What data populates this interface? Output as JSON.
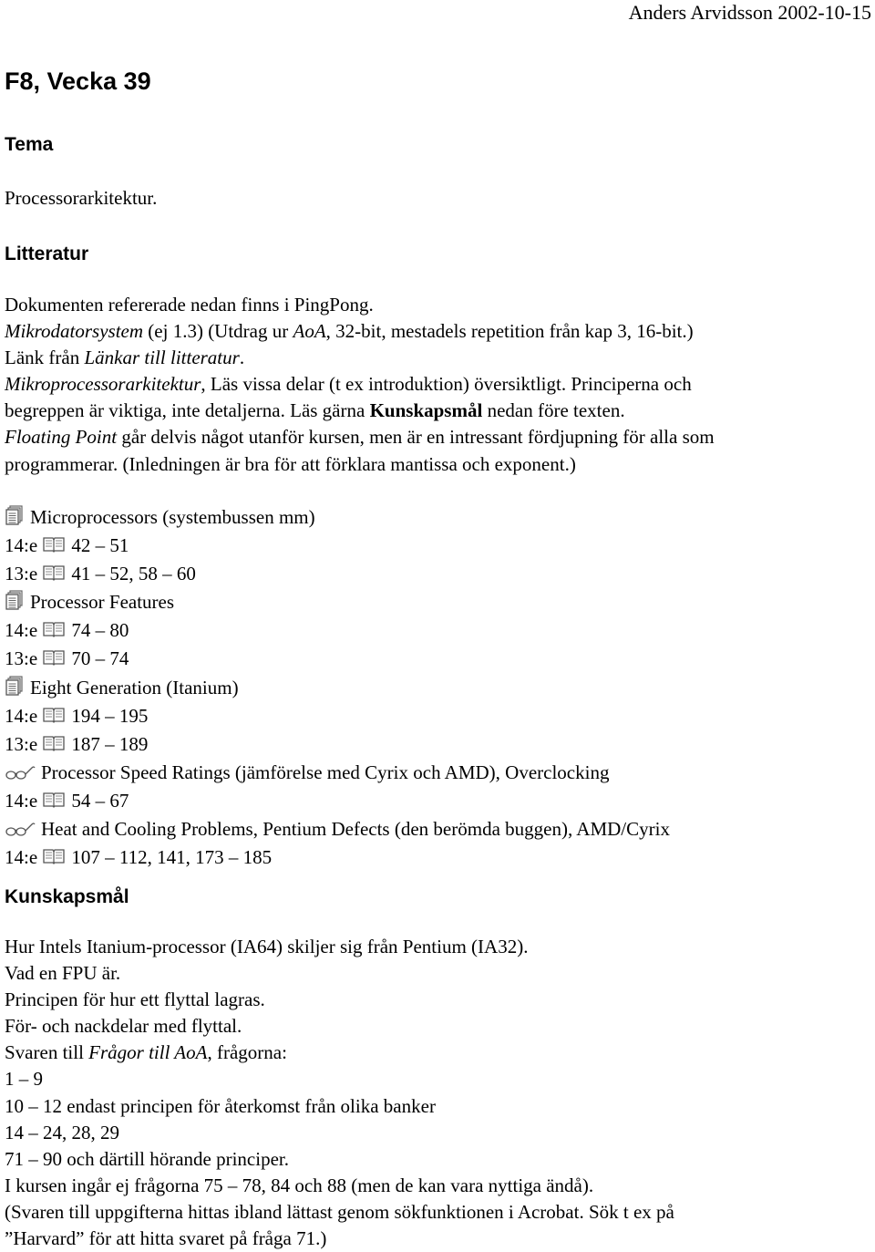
{
  "header": {
    "author_date": "Anders Arvidsson 2002-10-15"
  },
  "title": "F8, Vecka 39",
  "tema": {
    "heading": "Tema",
    "text": "Processorarkitektur."
  },
  "litteratur": {
    "heading": "Litteratur",
    "intro": "Dokumenten refererade nedan finns i PingPong.",
    "line1": {
      "title": "Mikrodatorsystem",
      "mid": " (ej 1.3) (Utdrag ur ",
      "aoa": "AoA",
      "rest": ", 32-bit, mestadels repetition från kap 3, 16-bit.)"
    },
    "line2": {
      "prefix": "Länk från ",
      "link": "Länkar till litteratur",
      "suffix": "."
    },
    "line3": {
      "title": "Mikroprocessorarkitektur",
      "rest1": ", Läs vissa delar (t ex introduktion) översiktligt. Principerna och",
      "rest2a": "begreppen är viktiga, inte detaljerna. Läs gärna ",
      "bold": "Kunskapsmål",
      "rest2b": " nedan före texten."
    },
    "line4": {
      "title": "Floating Point",
      "rest1": " går delvis något utanför kursen, men är en intressant fördjupning för alla som",
      "rest2": "programmerar. (Inledningen är bra för att förklara mantissa och exponent.)"
    }
  },
  "readings": [
    {
      "icon": "documents-icon",
      "title": "Microprocessors (systembussen mm)",
      "refs": [
        {
          "edition": "14:e",
          "icon": "book-icon",
          "pages": "42 – 51"
        },
        {
          "edition": "13:e",
          "icon": "book-icon",
          "pages": "41 – 52, 58 – 60"
        }
      ]
    },
    {
      "icon": "documents-icon",
      "title": "Processor Features",
      "refs": [
        {
          "edition": "14:e",
          "icon": "book-icon",
          "pages": "74 – 80"
        },
        {
          "edition": "13:e",
          "icon": "book-icon",
          "pages": "70 – 74"
        }
      ]
    },
    {
      "icon": "documents-icon",
      "title": "Eight Generation (Itanium)",
      "refs": [
        {
          "edition": "14:e",
          "icon": "book-icon",
          "pages": "194 – 195"
        },
        {
          "edition": "13:e",
          "icon": "book-icon",
          "pages": "187 – 189"
        }
      ]
    },
    {
      "icon": "glasses-icon",
      "title": "Processor Speed Ratings (jämförelse med Cyrix och AMD), Overclocking",
      "refs": [
        {
          "edition": "14:e",
          "icon": "book-icon",
          "pages": "54 – 67"
        }
      ]
    },
    {
      "icon": "glasses-icon",
      "title": "Heat and Cooling Problems, Pentium Defects (den berömda buggen), AMD/Cyrix",
      "refs": [
        {
          "edition": "14:e",
          "icon": "book-icon",
          "pages": "107 – 112, 141, 173 – 185"
        }
      ]
    }
  ],
  "kunskapsmal": {
    "heading": "Kunskapsmål",
    "lines": [
      "Hur Intels Itanium-processor  (IA64) skiljer sig från Pentium (IA32).",
      "Vad en FPU är.",
      "Principen för hur ett flyttal lagras.",
      "För- och nackdelar med flyttal."
    ],
    "svaren": {
      "prefix": "Svaren till ",
      "title": "Frågor till AoA",
      "suffix": ", frågorna:"
    },
    "questions": [
      "1 – 9",
      "10 – 12 endast principen för återkomst från olika banker",
      "14 – 24, 28, 29",
      "71 – 90 och därtill hörande principer.",
      "I kursen ingår ej frågorna 75 – 78, 84 och 88 (men de kan vara nyttiga ändå).",
      "(Svaren till uppgifterna hittas ibland lättast genom sökfunktionen i Acrobat. Sök t ex på",
      "”Harvard” för att hitta svaret på fråga 71.)"
    ]
  }
}
